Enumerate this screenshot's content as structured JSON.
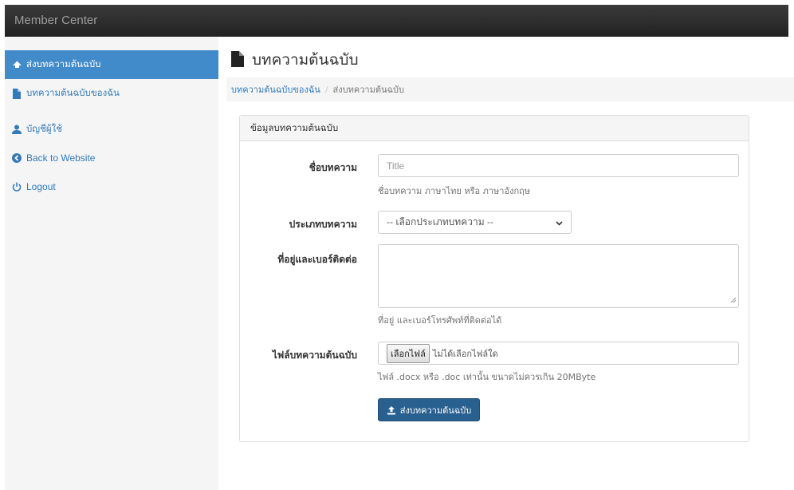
{
  "navbar": {
    "brand": "Member Center"
  },
  "sidebar": {
    "items": [
      {
        "label": "ส่งบทความต้นฉบับ",
        "icon": "send-icon"
      },
      {
        "label": "บทความต้นฉบับของฉัน",
        "icon": "file-icon"
      },
      {
        "label": "บัญชีผู้ใช้",
        "icon": "user-icon"
      },
      {
        "label": "Back to Website",
        "icon": "arrow-left-circle-icon"
      },
      {
        "label": "Logout",
        "icon": "power-icon"
      }
    ]
  },
  "page": {
    "title": "บทความต้นฉบับ"
  },
  "breadcrumb": {
    "link": "บทความต้นฉบับของฉัน",
    "separator": "/",
    "current": "ส่งบทความต้นฉบับ"
  },
  "panel": {
    "heading": "ข้อมูลบทความต้นฉบับ"
  },
  "form": {
    "title_label": "ชื่อบทความ",
    "title_placeholder": "Title",
    "title_help": "ชื่อบทความ ภาษาไทย หรือ ภาษาอังกฤษ",
    "type_label": "ประเภทบทความ",
    "type_selected": "-- เลือกประเภทบทความ --",
    "address_label": "ที่อยู่และเบอร์ติดต่อ",
    "address_help": "ที่อยู่ และเบอร์โทรศัพท์ที่ติดต่อได้",
    "file_label": "ไฟล์บทความต้นฉบับ",
    "file_button": "เลือกไฟล์",
    "file_status": "ไม่ได้เลือกไฟล์ใด",
    "file_help": "ไฟล์ .docx หรือ .doc เท่านั้น ขนาดไม่ควรเกิน 20MByte",
    "submit_label": "ส่งบทความต้นฉบับ"
  },
  "colors": {
    "navbar": "#222222",
    "active": "#428bca",
    "link": "#337ab7",
    "primary_button": "#286090"
  }
}
